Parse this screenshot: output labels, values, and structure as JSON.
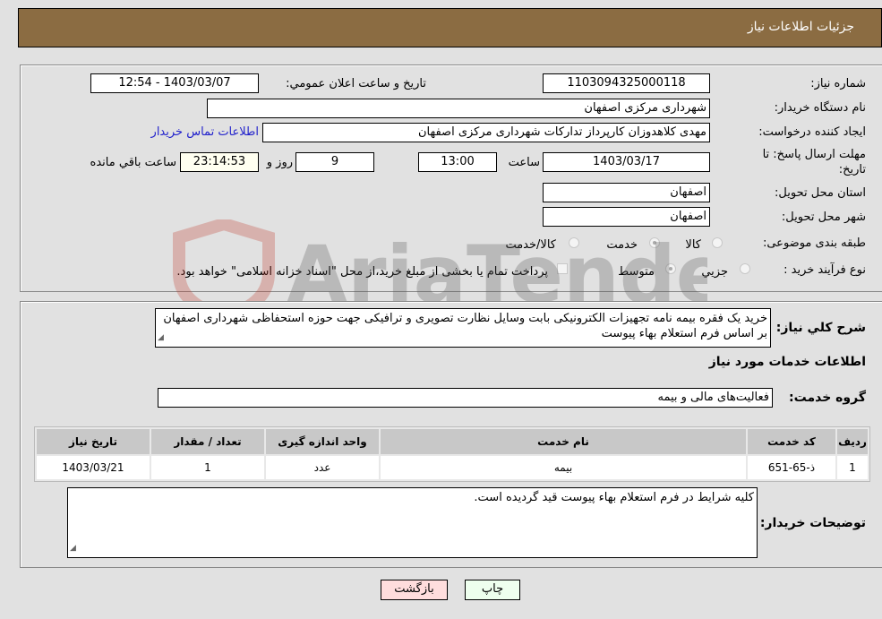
{
  "header": {
    "title": "جزئیات اطلاعات نیاز"
  },
  "form": {
    "need_number": {
      "label": "شماره نیاز:",
      "value": "1103094325000118"
    },
    "announce_datetime": {
      "label": "تاریخ و ساعت اعلان عمومي:",
      "value": "1403/03/07 - 12:54"
    },
    "buyer_org": {
      "label": "نام دستگاه خریدار:",
      "value": "شهرداری مرکزی اصفهان"
    },
    "requester": {
      "label": "ایجاد کننده درخواست:",
      "value": "مهدی کلاهدوزان کارپرداز تدارکات شهرداری مرکزی اصفهان"
    },
    "buyer_contact_link": "اطلاعات تماس خریدار",
    "deadline": {
      "label_line1": "مهلت ارسال پاسخ: تا",
      "label_line2": "تاریخ:",
      "date": "1403/03/17",
      "time_label": "ساعت",
      "time": "13:00",
      "days": "9",
      "days_label": "روز و",
      "remaining": "23:14:53",
      "remaining_label": "ساعت باقي مانده"
    },
    "delivery_province": {
      "label": "استان محل تحویل:",
      "value": "اصفهان"
    },
    "delivery_city": {
      "label": "شهر محل تحویل:",
      "value": "اصفهان"
    },
    "category": {
      "label": "طبقه بندی موضوعی:",
      "options": [
        "کالا",
        "خدمت",
        "کالا/خدمت"
      ],
      "selected": "خدمت"
    },
    "purchase_type": {
      "label": "نوع فرآیند خرید :",
      "options": [
        "جزيي",
        "متوسط"
      ],
      "selected": "متوسط",
      "treasury_note": "پرداخت تمام یا بخشی از مبلغ خرید،از محل \"اسناد خزانه اسلامی\" خواهد بود."
    }
  },
  "description": {
    "label": "شرح کلي نیاز:",
    "value": "خرید یک فقره بیمه نامه تجهیزات الکترونیکی بابت وسایل نظارت تصویری و ترافیکی جهت حوزه استحفاظی شهرداری اصفهان بر اساس فرم استعلام بهاء پیوست"
  },
  "services": {
    "section_title": "اطلاعات خدمات مورد نیاز",
    "group_label": "گروه خدمت:",
    "group_value": "فعالیت‌های مالی و بیمه",
    "table": {
      "headers": [
        "ردیف",
        "کد خدمت",
        "نام خدمت",
        "واحد اندازه گیری",
        "تعداد / مقدار",
        "تاریخ نیاز"
      ],
      "rows": [
        [
          "1",
          "ذ-65-651",
          "بیمه",
          "عدد",
          "1",
          "1403/03/21"
        ]
      ]
    }
  },
  "buyer_notes": {
    "label": "توضیحات خریدار:",
    "value": "کلیه شرایط در فرم استعلام بهاء پیوست قید گردیده است."
  },
  "buttons": {
    "print": "چاپ",
    "back": "بازگشت"
  },
  "watermark": {
    "text": "AriaTender.net"
  },
  "colors": {
    "header_bg": "#8b6c42",
    "print_bg": "#eeffee",
    "back_bg": "#ffdddd",
    "link": "#2222cc"
  }
}
